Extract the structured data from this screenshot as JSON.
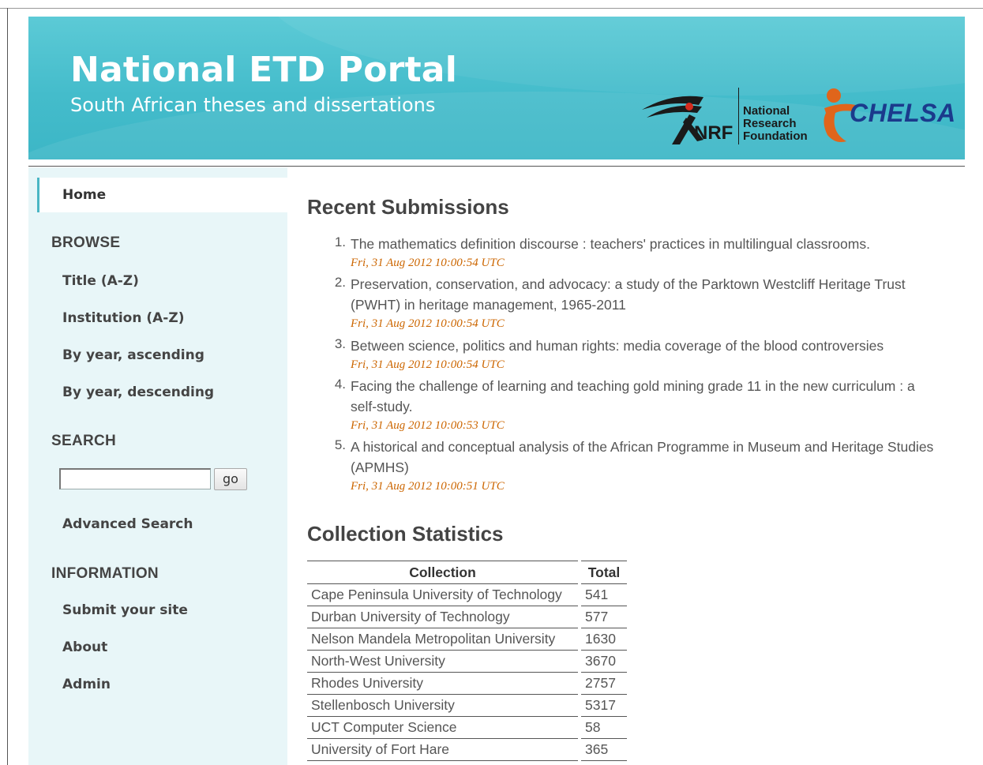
{
  "header": {
    "title": "National ETD Portal",
    "subtitle": "South African theses and dissertations",
    "logos": {
      "nrf": {
        "lines": [
          "National",
          "Research",
          "Foundation"
        ],
        "mark": "NRF"
      },
      "chelsa": {
        "text": "CHELSA"
      }
    },
    "colors": {
      "banner": "#44bccb",
      "chelsa_orange": "#e0651b",
      "chelsa_blue": "#1b3a8c"
    }
  },
  "sidebar": {
    "home": "Home",
    "browse_heading": "BROWSE",
    "browse_links": [
      "Title (A-Z)",
      "Institution (A-Z)",
      "By year, ascending",
      "By year, descending"
    ],
    "search_heading": "SEARCH",
    "search_input_value": "",
    "search_button": "go",
    "advanced_search": "Advanced Search",
    "info_heading": "INFORMATION",
    "info_links": [
      "Submit your site",
      "About",
      "Admin"
    ]
  },
  "recent": {
    "heading": "Recent Submissions",
    "items": [
      {
        "num": "1.",
        "title": "The mathematics definition discourse : teachers' practices in multilingual classrooms.",
        "date": "Fri, 31 Aug 2012 10:00:54 UTC"
      },
      {
        "num": "2.",
        "title": "Preservation, conservation, and advocacy: a study of the Parktown Westcliff Heritage Trust (PWHT) in heritage management, 1965-2011",
        "date": "Fri, 31 Aug 2012 10:00:54 UTC"
      },
      {
        "num": "3.",
        "title": "Between science, politics and human rights: media coverage of the blood controversies",
        "date": "Fri, 31 Aug 2012 10:00:54 UTC"
      },
      {
        "num": "4.",
        "title": "Facing the challenge of learning and teaching gold mining grade 11 in the new curriculum : a self-study.",
        "date": "Fri, 31 Aug 2012 10:00:53 UTC"
      },
      {
        "num": "5.",
        "title": "A historical and conceptual analysis of the African Programme in Museum and Heritage Studies (APMHS)",
        "date": "Fri, 31 Aug 2012 10:00:51 UTC"
      }
    ]
  },
  "stats": {
    "heading": "Collection Statistics",
    "columns": [
      "Collection",
      "Total"
    ],
    "rows": [
      [
        "Cape Peninsula University of Technology",
        "541"
      ],
      [
        "Durban University of Technology",
        "577"
      ],
      [
        "Nelson Mandela Metropolitan University",
        "1630"
      ],
      [
        "North-West University",
        "3670"
      ],
      [
        "Rhodes University",
        "2757"
      ],
      [
        "Stellenbosch University",
        "5317"
      ],
      [
        "UCT Computer Science",
        "58"
      ],
      [
        "University of Fort Hare",
        "365"
      ]
    ]
  }
}
